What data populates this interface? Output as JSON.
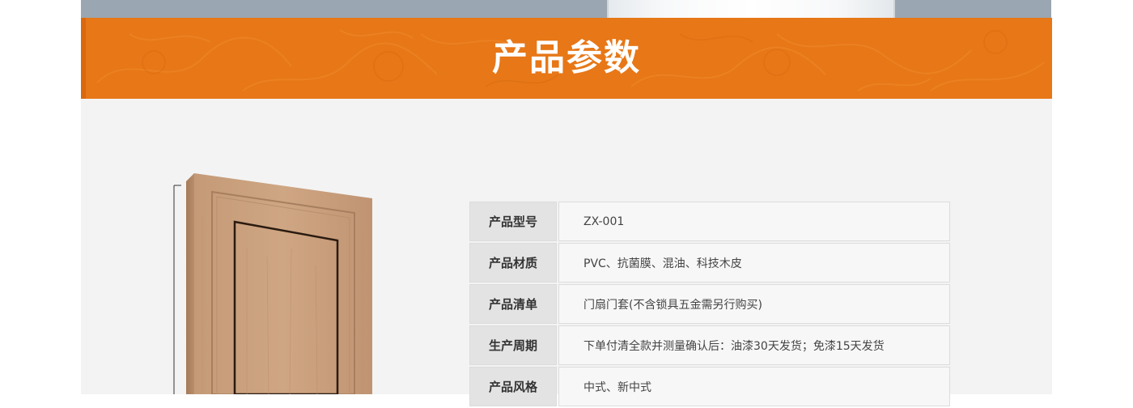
{
  "header": {
    "title": "产品参数"
  },
  "colors": {
    "banner": "#e77717",
    "content_bg": "#f3f3f3",
    "label_bg": "#e3e3e3",
    "value_bg": "#f7f7f7"
  },
  "product_image": {
    "icon": "wooden-door-image"
  },
  "specs": [
    {
      "label": "产品型号",
      "value": "ZX-001"
    },
    {
      "label": "产品材质",
      "value": "PVC、抗菌膜、混油、科技木皮"
    },
    {
      "label": "产品清单",
      "value": "门扇门套(不含锁具五金需另行购买)"
    },
    {
      "label": "生产周期",
      "value": "下单付清全款并测量确认后：油漆30天发货；免漆15天发货"
    },
    {
      "label": "产品风格",
      "value": "中式、新中式"
    }
  ]
}
